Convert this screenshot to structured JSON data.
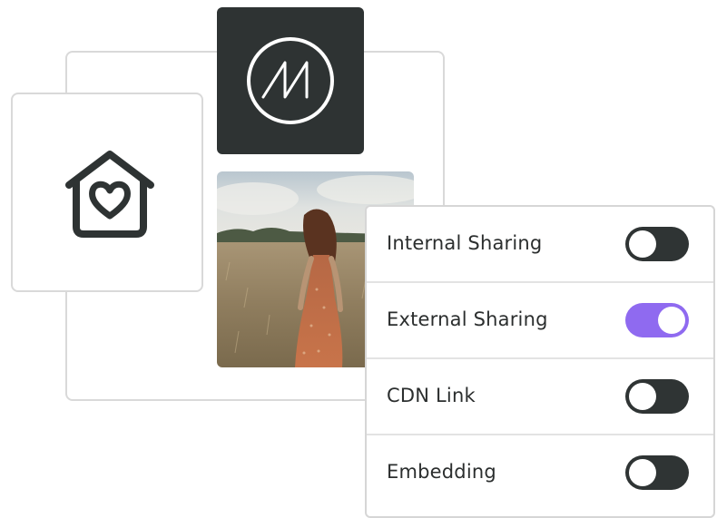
{
  "logo": {
    "icon": "m-monogram-logo"
  },
  "home_card": {
    "icon": "home-heart-icon"
  },
  "photo": {
    "description_icon": "photo-image"
  },
  "settings": {
    "items": [
      {
        "label": "Internal Sharing",
        "enabled": false
      },
      {
        "label": "External Sharing",
        "enabled": true
      },
      {
        "label": "CDN Link",
        "enabled": false
      },
      {
        "label": "Embedding",
        "enabled": false
      }
    ]
  },
  "colors": {
    "dark": "#2e3333",
    "accent": "#8f6af0",
    "border": "#d9d9d9",
    "text": "#2b2e2e"
  }
}
